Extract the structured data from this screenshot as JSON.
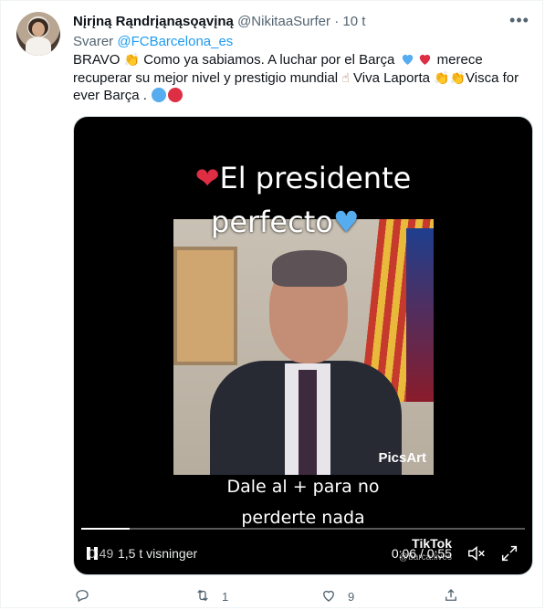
{
  "tweet": {
    "display_name": "Nįrįną Rąndrįąnąsǫąvįną",
    "handle": "@NikitaaSurfer",
    "separator": "·",
    "time": "10 t",
    "reply_prefix": "Svarer",
    "reply_to": "@FCBarcelona_es",
    "text_1": "BRAVO",
    "text_2": "Como ya sabiamos.  A luchar por el Barça",
    "text_3": "merece recuperar su mejor nivel y prestigio mundial",
    "text_4": "Viva Laporta",
    "text_5": "Visca for ever Barça ."
  },
  "media": {
    "overlay_title_line1": "El presidente",
    "overlay_title_line2": "perfecto",
    "watermark": "PicsArt",
    "caption_line1": "Dale al + para no",
    "caption_line2": "perderte nada",
    "progress": 0.11,
    "views_ghost": "0:49",
    "views": "1,5 t visninger",
    "tiktok_label": "TikTok",
    "tiktok_handle": "@barca.lives",
    "timer": "0:06 / 0:55"
  },
  "actions": {
    "reply_count": "",
    "retweet_count": "1",
    "like_count": "9",
    "share_count": ""
  },
  "colors": {
    "accent": "#1d9bf0",
    "muted": "#536471",
    "text": "#0f1419"
  },
  "icons": [
    "more-icon",
    "reply-icon",
    "retweet-icon",
    "like-icon",
    "share-icon",
    "mute-icon",
    "fullscreen-icon",
    "pause-icon"
  ]
}
